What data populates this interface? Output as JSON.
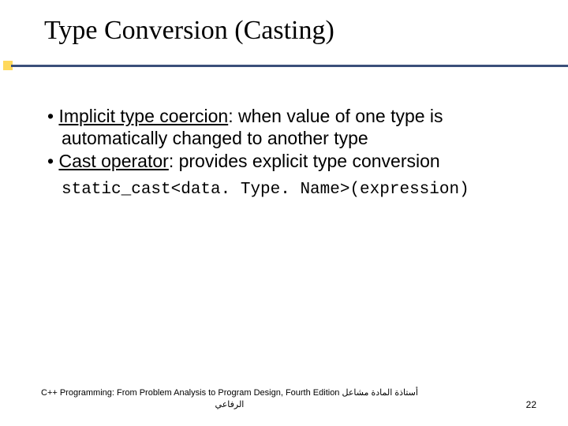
{
  "title": "Type Conversion (Casting)",
  "bullets": [
    {
      "term": "Implicit type coercion",
      "rest": ": when value of one type is automatically changed to another type"
    },
    {
      "term": "Cast operator",
      "rest": ": provides explicit type conversion"
    }
  ],
  "code": "static_cast<data. Type. Name>(expression)",
  "footer": {
    "line1": "C++ Programming: From Problem Analysis to Program Design, Fourth Edition أستاذة المادة مشاعل",
    "line2": "الرفاعي",
    "page": "22"
  }
}
